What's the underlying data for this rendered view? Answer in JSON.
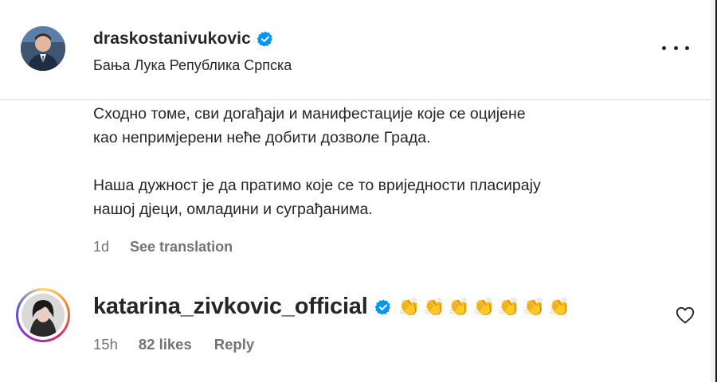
{
  "post": {
    "username": "draskostanivukovic",
    "location": "Бања Лука Република Српска",
    "avatar_icon": "profile-photo-man-suit",
    "more_icon": "more-options-icon"
  },
  "caption": {
    "paragraph1_line1": "Сходно томе, сви догађаји и манифестације које се оцијене",
    "paragraph1_line2": "као непримјерени неће добити дозволе Града.",
    "paragraph2_line1": "Наша дужност је да пратимо које се то вриједности пласирају",
    "paragraph2_line2": "нашој дјеци, омладини и суграђанима.",
    "time": "1d",
    "see_translation": "See translation"
  },
  "comment": {
    "username": "katarina_zivkovic_official",
    "text": "👏👏👏👏👏👏👏",
    "time": "15h",
    "likes": "82 likes",
    "reply": "Reply",
    "heart_icon": "heart-outline-icon"
  },
  "colors": {
    "text": "#262626",
    "secondary": "#737373",
    "verified_blue": "#0095f6",
    "divider": "#dbdbdb"
  }
}
